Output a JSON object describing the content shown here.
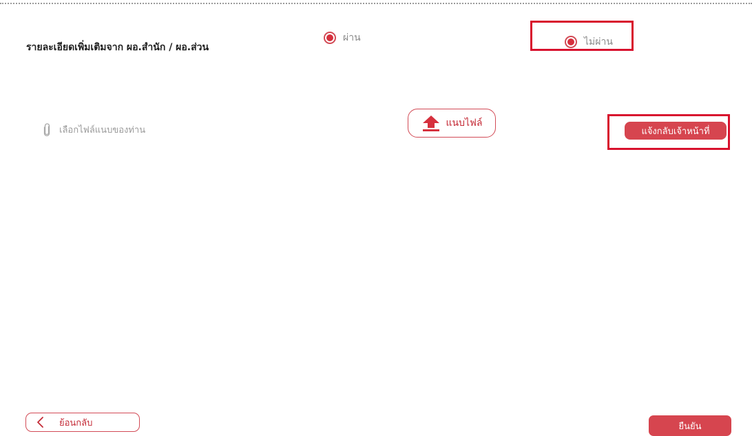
{
  "form": {
    "detail_label": "รายละเอียดเพิ่มเติมจาก ผอ.สำนัก / ผอ.ส่วน",
    "options": {
      "pass": "ผ่าน",
      "fail": "ไม่ผ่าน"
    },
    "attach_placeholder": "เลือกไฟล์แนบของท่าน",
    "upload_label": "แนบไฟล์",
    "notify_label": "แจ้งกลับเจ้าหน้าที่"
  },
  "footer": {
    "back_label": "ย้อนกลับ",
    "confirm_label": "ยืนยัน"
  },
  "icons": {
    "attach": "paperclip-icon",
    "upload": "upload-arrow-icon",
    "back": "chevron-left-icon"
  },
  "colors": {
    "accent": "#d6454f",
    "highlight": "#d8112d"
  }
}
